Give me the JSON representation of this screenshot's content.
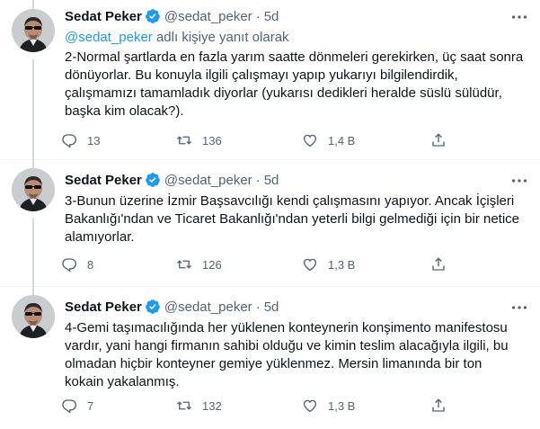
{
  "colors": {
    "accent": "#1d9bf0",
    "secondary_text": "#536471",
    "primary_text": "#0f1419"
  },
  "tweets": [
    {
      "author_name": "Sedat Peker",
      "handle": "@sedat_peker",
      "separator": "·",
      "time": "5d",
      "reply_mention": "@sedat_peker",
      "reply_suffix": " adlı kişiye yanıt olarak",
      "lines": [
        "2-Normal şartlarda en fazla yarım saatte dönmeleri gerekirken, üç saat sonra",
        "dönüyorlar. Bu konuyla ilgili çalışmayı yapıp yukarıyı bilgilendirdik,",
        "çalışmamızı tamamladık diyorlar (yukarısı dedikleri heralde süslü sülüdür,",
        "başka kim olacak?)."
      ],
      "replies": "13",
      "retweets": "136",
      "likes": "1,4 B"
    },
    {
      "author_name": "Sedat Peker",
      "handle": "@sedat_peker",
      "separator": "·",
      "time": "5d",
      "lines": [
        "3-Bunun üzerine İzmir Başsavcılığı kendi çalışmasını yapıyor. Ancak İçişleri",
        "Bakanlığı'ndan ve Ticaret Bakanlığı'ndan yeterli bilgi gelmediği için bir netice",
        "alamıyorlar."
      ],
      "replies": "8",
      "retweets": "126",
      "likes": "1,3 B"
    },
    {
      "author_name": "Sedat Peker",
      "handle": "@sedat_peker",
      "separator": "·",
      "time": "5d",
      "lines": [
        "4-Gemi taşımacılığında her yüklenen konteynerin konşimento manifestosu",
        "vardır, yani hangi firmanın sahibi olduğu ve kimin teslim alacağıyla ilgili, bu",
        "olmadan hiçbir konteyner gemiye yüklenmez. Mersin limanında bir ton",
        "kokain yakalanmış."
      ],
      "replies": "7",
      "retweets": "132",
      "likes": "1,3 B"
    }
  ]
}
